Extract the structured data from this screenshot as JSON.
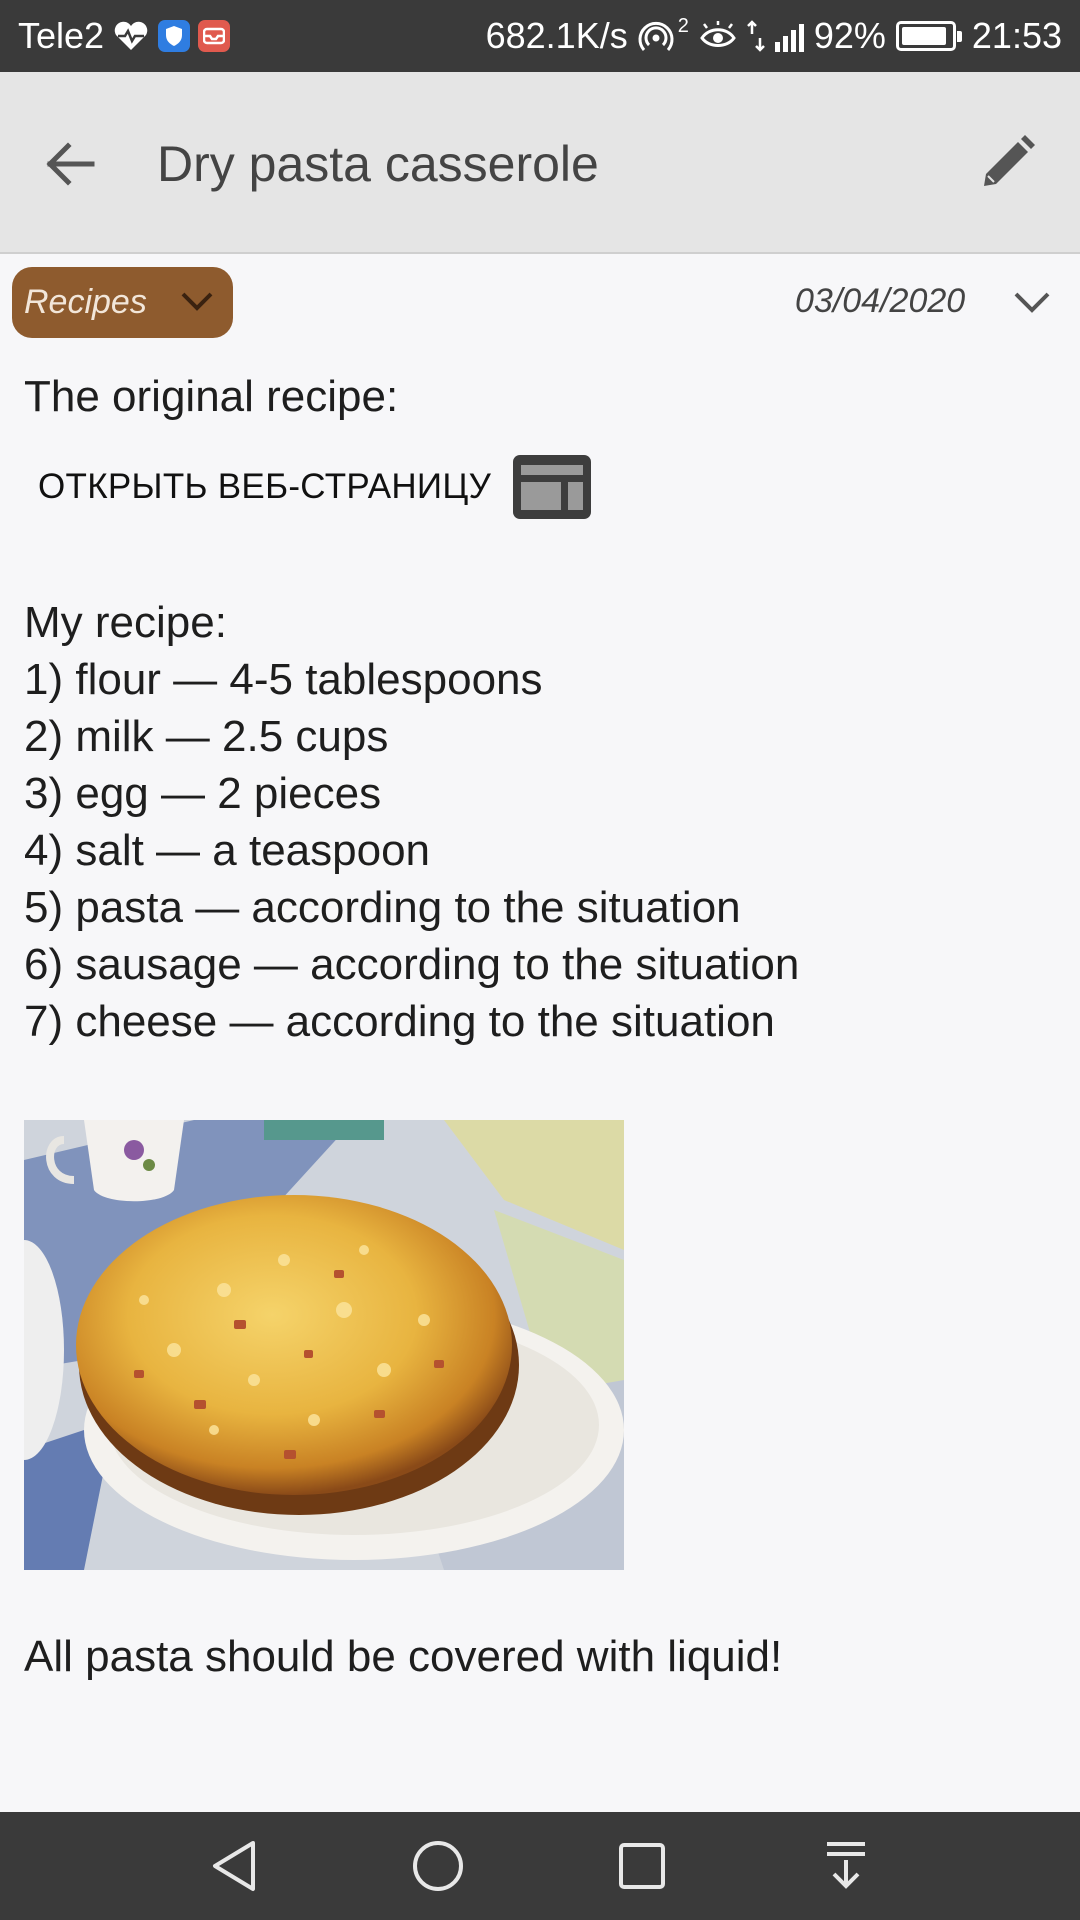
{
  "status_bar": {
    "carrier": "Tele2",
    "net_speed": "682.1K/s",
    "hotspot_count": "2",
    "battery": "92%",
    "battery_level": 0.92,
    "time": "21:53",
    "icons": [
      "heart-monitor-icon",
      "shield-app-icon",
      "mail-app-icon",
      "hotspot-icon",
      "eye-comfort-icon",
      "data-arrows-icon",
      "signal-icon",
      "battery-icon"
    ]
  },
  "app_bar": {
    "title": "Dry pasta casserole",
    "back_icon": "arrow-back-icon",
    "edit_icon": "pencil-icon"
  },
  "meta": {
    "category": "Recipes",
    "date": "03/04/2020",
    "category_color": "#8e5b2e"
  },
  "note": {
    "original_label": "The original recipe:",
    "web_link_label": "ОТКРЫТЬ ВЕБ-СТРАНИЦУ",
    "recipe_title": "My recipe:",
    "ingredients": [
      "1) flour — 4-5 tablespoons",
      "2) milk — 2.5 cups",
      "3) egg — 2 pieces",
      "4) salt — a teaspoon",
      "5) pasta — according to the situation",
      "6) sausage — according to the situation",
      "7) cheese — according to the situation"
    ],
    "footer": "All pasta should be covered with liquid!"
  },
  "nav_bar": {
    "buttons": [
      "back-triangle-icon",
      "home-circle-icon",
      "recents-square-icon",
      "notifications-pull-icon"
    ]
  }
}
